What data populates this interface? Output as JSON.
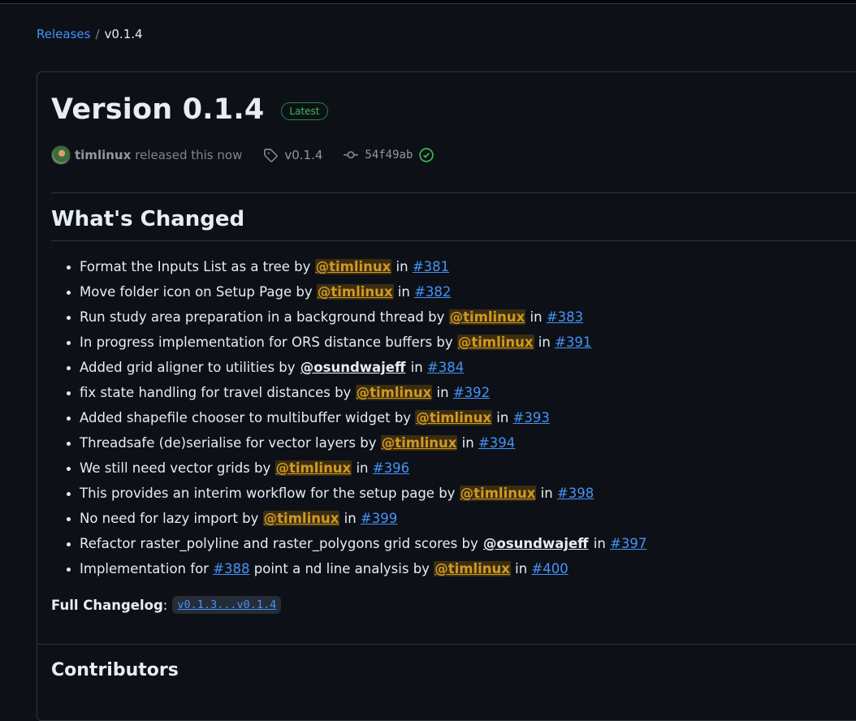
{
  "breadcrumb": {
    "root": "Releases",
    "sep": "/",
    "current": "v0.1.4"
  },
  "release": {
    "title": "Version 0.1.4",
    "badge": "Latest",
    "author": "timlinux",
    "released_text": "released this now",
    "tag": "v0.1.4",
    "commit": "54f49ab"
  },
  "section_title": "What's Changed",
  "changes": [
    {
      "pre": "Format the Inputs List as a tree by ",
      "user": "@timlinux",
      "mid": " in ",
      "pr": "#381"
    },
    {
      "pre": "Move folder icon on Setup Page by ",
      "user": "@timlinux",
      "mid": " in ",
      "pr": "#382"
    },
    {
      "pre": "Run study area preparation in a background thread by ",
      "user": "@timlinux",
      "mid": " in ",
      "pr": "#383"
    },
    {
      "pre": "In progress implementation for ORS distance buffers by ",
      "user": "@timlinux",
      "mid": " in ",
      "pr": "#391"
    },
    {
      "pre": "Added grid aligner to utilities by ",
      "user": "@osundwajeff",
      "mid": " in ",
      "pr": "#384"
    },
    {
      "pre": "fix state handling for travel distances by ",
      "user": "@timlinux",
      "mid": " in ",
      "pr": "#392"
    },
    {
      "pre": "Added shapefile chooser to multibuffer widget by ",
      "user": "@timlinux",
      "mid": " in ",
      "pr": "#393"
    },
    {
      "pre": "Threadsafe (de)serialise for vector layers by ",
      "user": "@timlinux",
      "mid": " in ",
      "pr": "#394"
    },
    {
      "pre": "We still need vector grids by ",
      "user": "@timlinux",
      "mid": " in ",
      "pr": "#396"
    },
    {
      "pre": "This provides an interim workflow for the setup page by ",
      "user": "@timlinux",
      "mid": " in ",
      "pr": "#398"
    },
    {
      "pre": "No need for lazy import by ",
      "user": "@timlinux",
      "mid": " in ",
      "pr": "#399"
    },
    {
      "pre": "Refactor raster_polyline and raster_polygons grid scores by ",
      "user": "@osundwajeff",
      "mid": " in ",
      "pr": "#397"
    }
  ],
  "last_change": {
    "pre": "Implementation for ",
    "pr1": "#388",
    "mid1": " point a nd line analysis by ",
    "user": "@timlinux",
    "mid2": " in ",
    "pr2": "#400"
  },
  "full_changelog": {
    "label": "Full Changelog",
    "colon": ":",
    "link": "v0.1.3...v0.1.4"
  },
  "contributors_title": "Contributors",
  "colors": {
    "link": "#4493f8",
    "mention": "#d29922",
    "badge": "#3fb950",
    "bg": "#0d1117"
  },
  "icons": {
    "tag": "tag-icon",
    "commit": "git-commit-icon",
    "verified": "verified-check-icon"
  }
}
